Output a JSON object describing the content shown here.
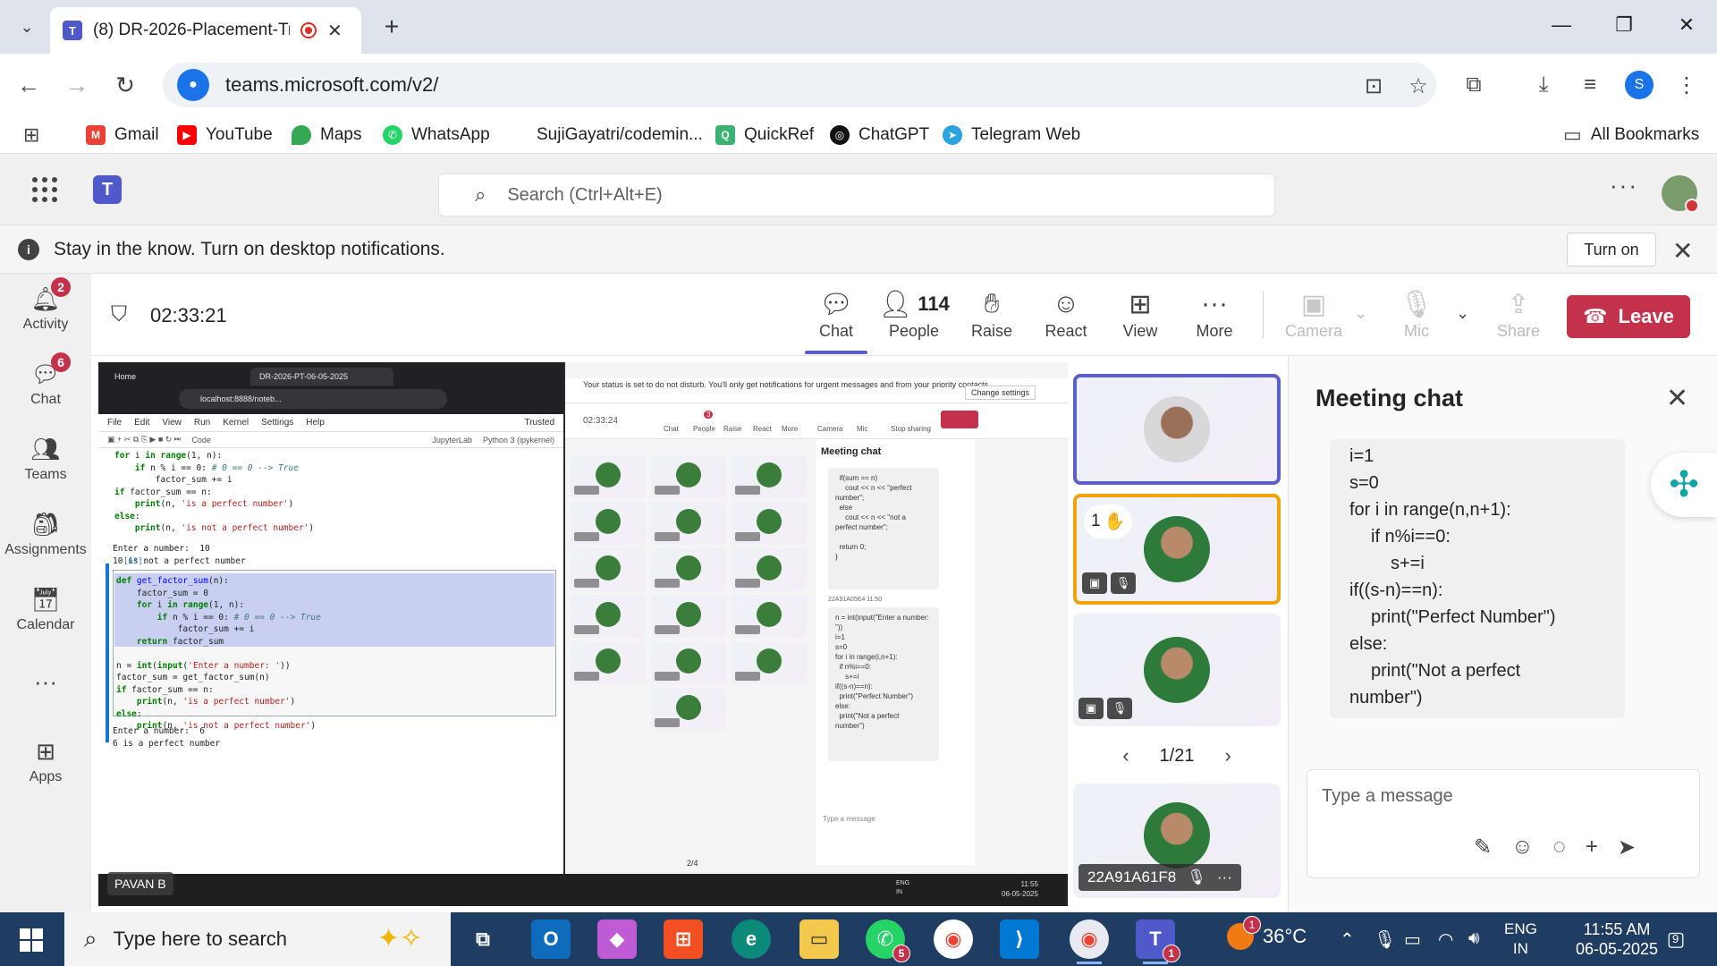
{
  "browser": {
    "tab_title": "(8) DR-2026-Placement-Trai",
    "url": "teams.microsoft.com/v2/",
    "bookmarks": [
      "Gmail",
      "YouTube",
      "Maps",
      "WhatsApp",
      "SujiGayatri/codemin...",
      "QuickRef",
      "ChatGPT",
      "Telegram Web"
    ],
    "all_bookmarks": "All Bookmarks",
    "profile_initial": "S"
  },
  "teams": {
    "search_placeholder": "Search (Ctrl+Alt+E)",
    "banner_text": "Stay in the know. Turn on desktop notifications.",
    "banner_button": "Turn on",
    "rail": [
      {
        "label": "Activity",
        "badge": "2"
      },
      {
        "label": "Chat",
        "badge": "6"
      },
      {
        "label": "Teams",
        "badge": ""
      },
      {
        "label": "Assignments",
        "badge": ""
      },
      {
        "label": "Calendar",
        "badge": ""
      },
      {
        "label": "Apps",
        "badge": ""
      }
    ]
  },
  "meeting": {
    "timer": "02:33:21",
    "controls": {
      "chat": "Chat",
      "people": "People",
      "people_count": "114",
      "raise": "Raise",
      "react": "React",
      "view": "View",
      "more": "More",
      "camera": "Camera",
      "mic": "Mic",
      "share": "Share",
      "leave": "Leave"
    },
    "presenter_name": "PAVAN B",
    "pager": "1/21",
    "raised_hand_count": "1",
    "tile_name": "22A91A61F8"
  },
  "shared_screen": {
    "tabs": [
      "Home",
      "DR-2026-PT-06-05-2025"
    ],
    "url": "localhost:8888/noteb...",
    "menu": [
      "File",
      "Edit",
      "View",
      "Run",
      "Kernel",
      "Settings",
      "Help"
    ],
    "trusted": "Trusted",
    "cell_type": "Code",
    "kernel": "Python 3 (ipykernel)",
    "jupyterlab": "JupyterLab",
    "output1_a": "Enter a number:  10",
    "output1_b": "10 is not a perfect number",
    "prompt": "[63]:",
    "output2_a": "Enter a number:  6",
    "output2_b": "6 is a perfect number",
    "status_text": "Your status is set to do not disturb. You'll only get notifications for urgent messages and from your priority contacts.",
    "change_settings": "Change settings",
    "inner_timer": "02:33:24",
    "inner_chat_title": "Meeting chat",
    "inner_sender": "22A91A05E4  11:50",
    "inner_type": "Type a message",
    "inner_pager": "2/4",
    "inner_controls": [
      "Chat",
      "People",
      "Raise",
      "React",
      "More",
      "Camera",
      "Mic",
      "Stop sharing"
    ],
    "inner_people_badge": "3",
    "inner_clock_time": "11:55",
    "inner_clock_date": "06-05-2025",
    "inner_lang": "ENG",
    "inner_region": "IN"
  },
  "chat": {
    "title": "Meeting chat",
    "code_lines": [
      "i=1",
      "s=0",
      "for i in range(n,n+1):",
      "if n%i==0:",
      "s+=i",
      "if((s-n)==n):",
      "print(\"Perfect Number\")",
      "else:",
      "print(\"Not a perfect",
      "number\")"
    ],
    "compose_placeholder": "Type a message"
  },
  "taskbar": {
    "search_placeholder": "Type here to search",
    "temperature": "36°C",
    "lang": "ENG",
    "region": "IN",
    "time": "11:55 AM",
    "date": "06-05-2025",
    "whatsapp_badge": "5",
    "teams_badge": "1",
    "weather_badge": "1",
    "notif_count": "9"
  }
}
